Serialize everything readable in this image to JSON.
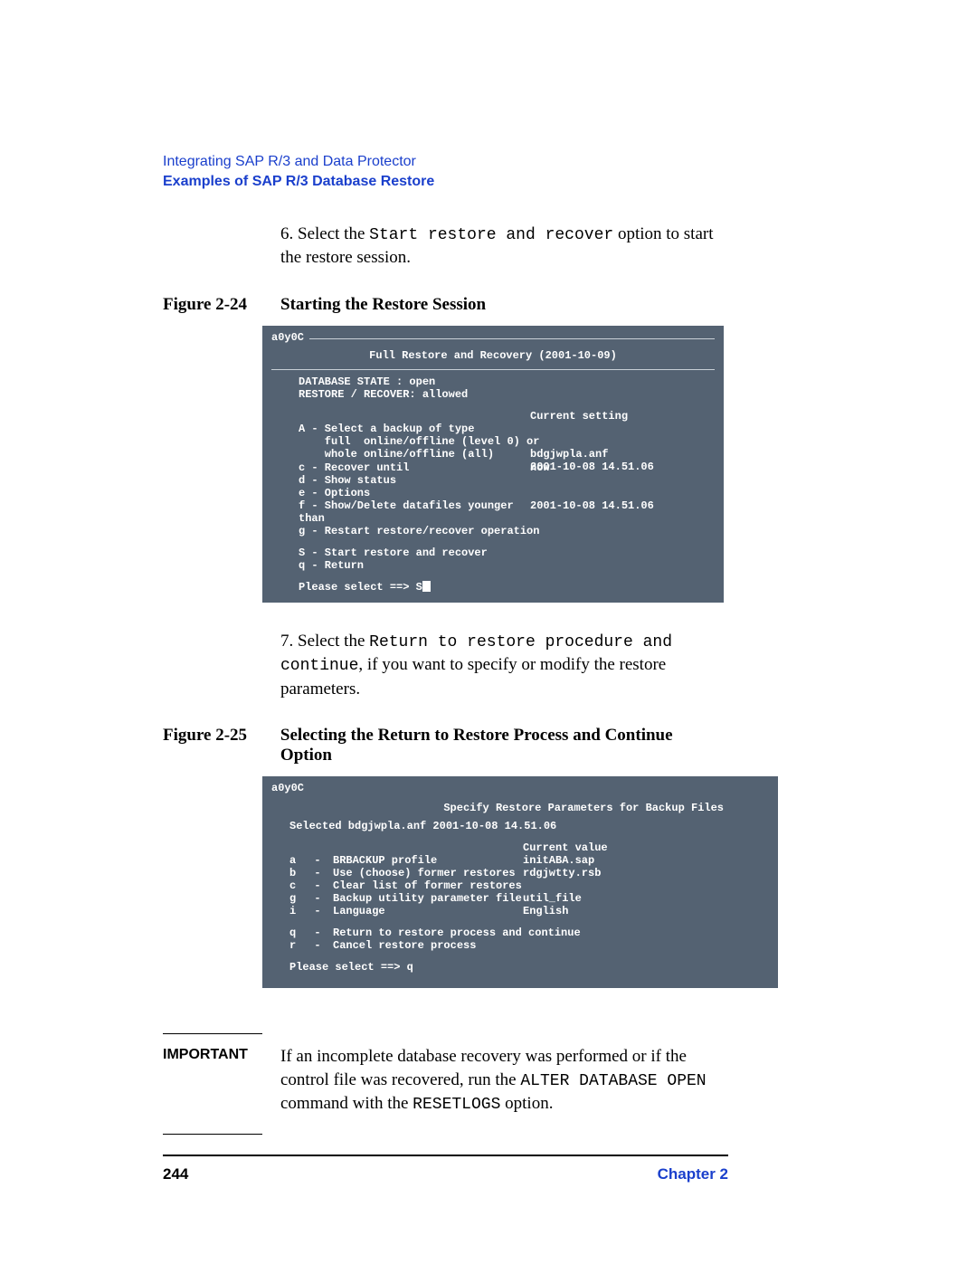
{
  "header": {
    "chapter_title": "Integrating SAP R/3 and Data Protector",
    "section_title": "Examples of SAP R/3 Database Restore"
  },
  "step6": {
    "num": "6.",
    "pre": "Select the ",
    "code": "Start restore and recover",
    "post": " option to start the restore session."
  },
  "figure24": {
    "label": "Figure 2-24",
    "caption": "Starting the Restore Session"
  },
  "terminal1": {
    "prompt": "a0y0C",
    "title": "Full Restore and Recovery (2001-10-09)",
    "db_state_label": "DATABASE STATE   : open",
    "restore_label": "RESTORE / RECOVER: allowed",
    "col_right_head": "Current setting",
    "lineA": "A - Select a backup of type",
    "lineA2": "    full  online/offline (level 0) or",
    "lineA3_left": "    whole online/offline (all)",
    "lineA3_right1": "bdgjwpla.anf",
    "lineA3_right2": "2001-10-08 14.51.06",
    "lineC_left": "c - Recover until",
    "lineC_right": "now",
    "lineD": "d - Show status",
    "lineE": "e - Options",
    "lineF_left": "f - Show/Delete datafiles younger than",
    "lineF_right": "2001-10-08 14.51.06",
    "lineG": "g - Restart restore/recover operation",
    "lineS": "S - Start restore and recover",
    "lineQ": "q - Return",
    "select": "Please select  ==>  S"
  },
  "step7": {
    "num": "7.",
    "pre": "Select the ",
    "code": "Return to restore procedure and continue",
    "post": ", if you want to specify or modify the restore parameters."
  },
  "figure25": {
    "label": "Figure 2-25",
    "caption": "Selecting the Return to Restore Process and Continue Option"
  },
  "terminal2": {
    "prompt": "a0y0C",
    "title": "Specify Restore Parameters for Backup Files",
    "selected": "Selected  bdgjwpla.anf 2001-10-08 14.51.06",
    "cv": "Current value",
    "a": {
      "k": "a",
      "d": "-",
      "l": "BRBACKUP profile",
      "v": "initABA.sap"
    },
    "b": {
      "k": "b",
      "d": "-",
      "l": "Use (choose) former restores",
      "v": "rdgjwtty.rsb"
    },
    "c": {
      "k": "c",
      "d": "-",
      "l": "Clear list of former restores",
      "v": ""
    },
    "g": {
      "k": "g",
      "d": "-",
      "l": "Backup utility parameter file",
      "v": "util_file"
    },
    "i": {
      "k": "i",
      "d": "-",
      "l": "Language",
      "v": "English"
    },
    "q": {
      "k": "q",
      "d": "-",
      "l": "Return to restore process and continue",
      "v": ""
    },
    "r": {
      "k": "r",
      "d": "-",
      "l": "Cancel restore process",
      "v": ""
    },
    "select": "Please select  ==> q"
  },
  "important": {
    "label": "IMPORTANT",
    "pre": "If an incomplete database recovery was performed or if the control file was recovered, run the ",
    "code1": "ALTER DATABASE OPEN",
    "mid": " command with the ",
    "code2": "RESETLOGS",
    "post": " option."
  },
  "footer": {
    "page": "244",
    "chapter": "Chapter 2"
  }
}
